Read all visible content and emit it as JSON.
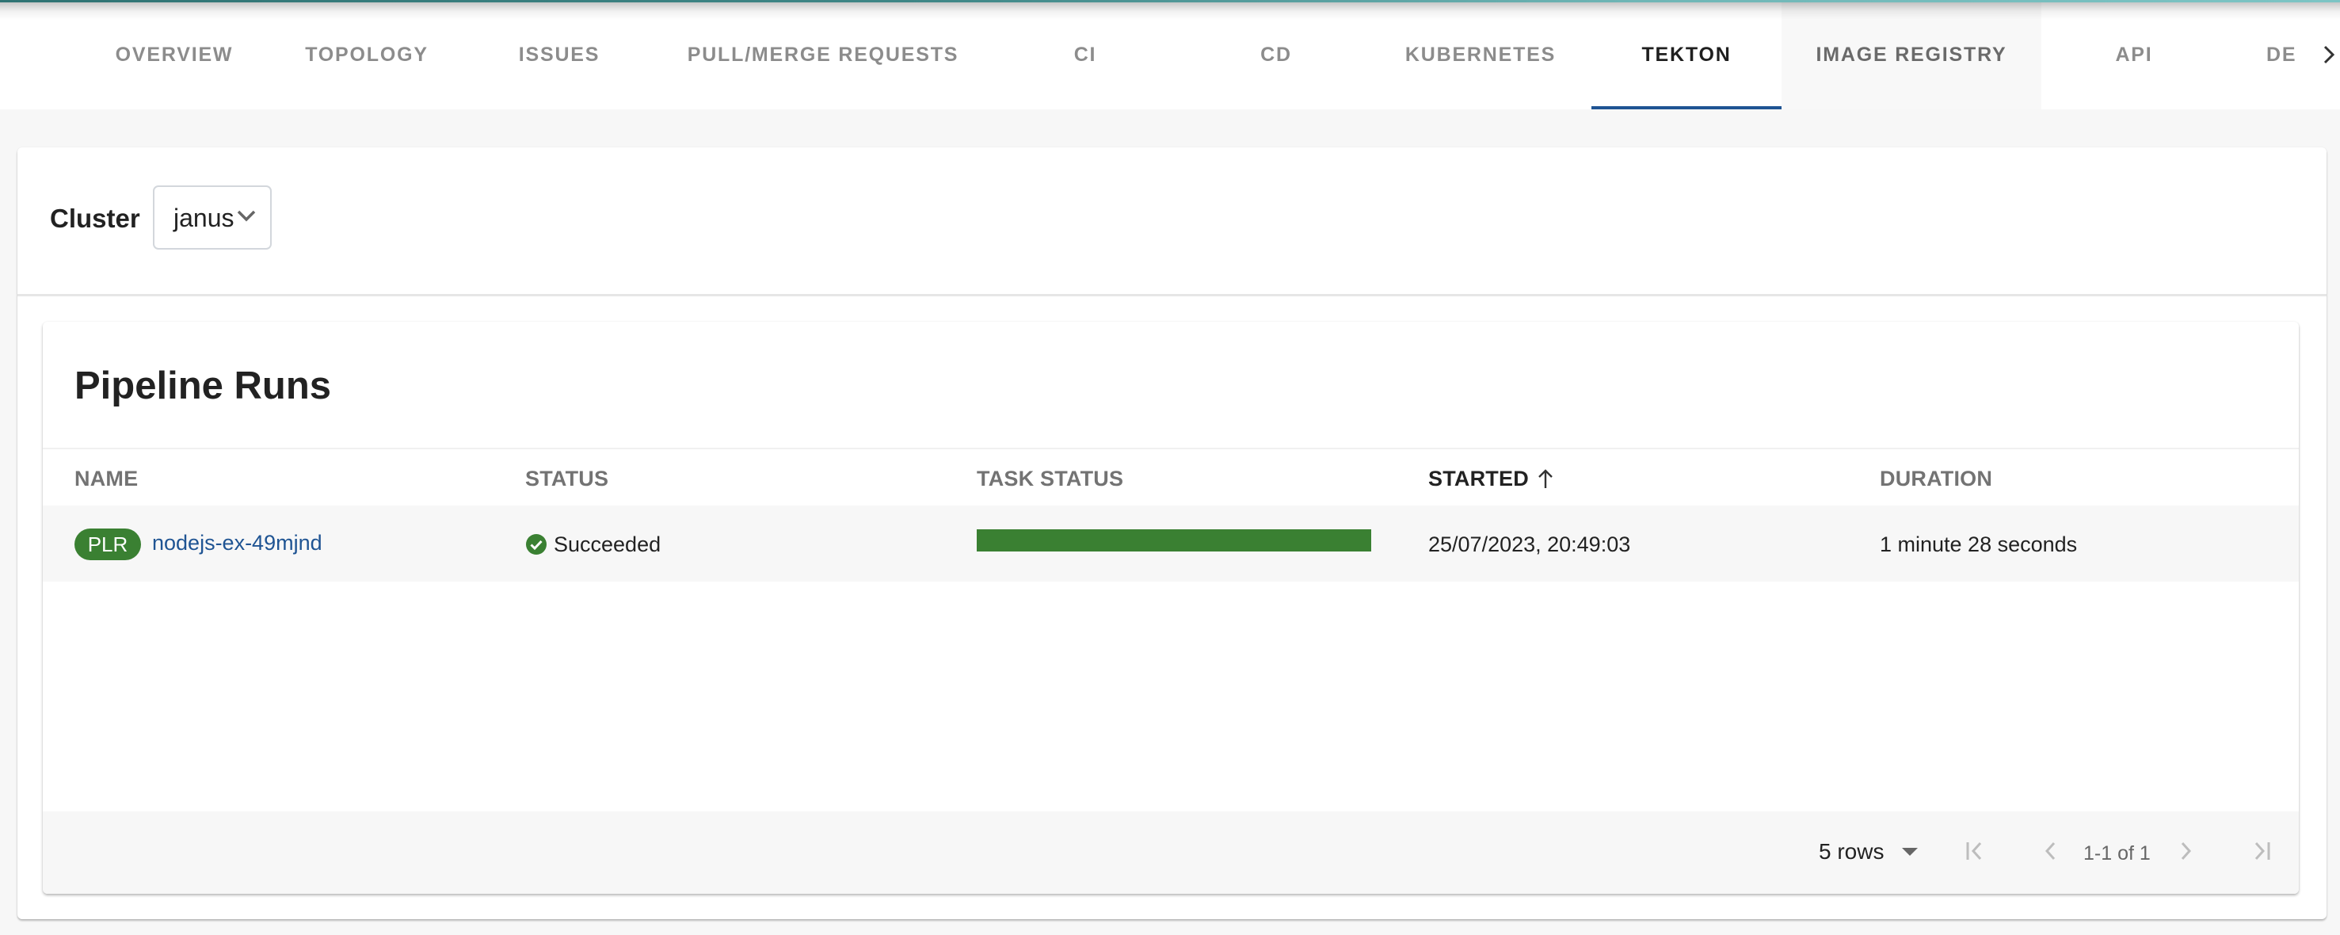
{
  "tabs": [
    {
      "label": "OVERVIEW",
      "state": "normal"
    },
    {
      "label": "TOPOLOGY",
      "state": "normal"
    },
    {
      "label": "ISSUES",
      "state": "normal"
    },
    {
      "label": "PULL/MERGE REQUESTS",
      "state": "normal"
    },
    {
      "label": "CI",
      "state": "normal"
    },
    {
      "label": "CD",
      "state": "normal"
    },
    {
      "label": "KUBERNETES",
      "state": "normal"
    },
    {
      "label": "TEKTON",
      "state": "active"
    },
    {
      "label": "IMAGE REGISTRY",
      "state": "hover"
    },
    {
      "label": "API",
      "state": "normal"
    },
    {
      "label": "DE",
      "state": "normal"
    }
  ],
  "tab_scroll_icon": "chevron-right-icon",
  "cluster": {
    "label": "Cluster",
    "selected": "janus",
    "icon": "chevron-down-icon"
  },
  "pipeline_runs": {
    "title": "Pipeline Runs",
    "columns": [
      {
        "label": "NAME"
      },
      {
        "label": "STATUS"
      },
      {
        "label": "TASK STATUS"
      },
      {
        "label": "STARTED",
        "sorted": "ascending",
        "icon": "arrow-up-icon"
      },
      {
        "label": "DURATION"
      }
    ],
    "rows": [
      {
        "badge": "PLR",
        "name": "nodejs-ex-49mjnd",
        "status": "Succeeded",
        "status_icon": "check-circle-icon",
        "task_status_fraction": 1.0,
        "started": "25/07/2023, 20:49:03",
        "duration": "1 minute 28 seconds"
      }
    ],
    "pagination": {
      "rows_per_page": "5 rows",
      "page_info": "1-1 of 1",
      "icons": [
        "first-page-icon",
        "previous-page-icon",
        "next-page-icon",
        "last-page-icon"
      ]
    }
  },
  "colors": {
    "accent": "#1f5493",
    "success": "#3a8032",
    "header_teal": "#3f8787"
  }
}
